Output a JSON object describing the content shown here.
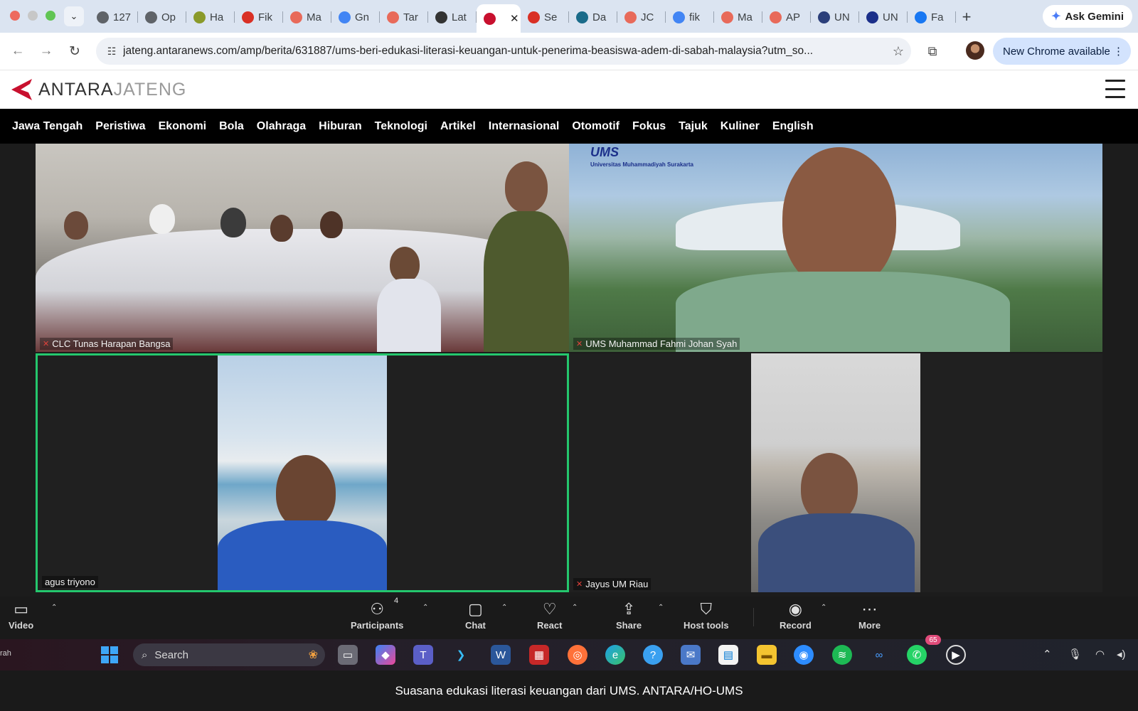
{
  "browser": {
    "tabs": [
      {
        "label": "127",
        "icon": "globe-icon",
        "color": "#5f6368"
      },
      {
        "label": "Op",
        "icon": "openai-icon",
        "color": "#5f6368"
      },
      {
        "label": "Ha",
        "icon": "seal-icon",
        "color": "#8a9a2a"
      },
      {
        "label": "Fik",
        "icon": "r-icon",
        "color": "#d93025"
      },
      {
        "label": "Ma",
        "icon": "asterisk-icon",
        "color": "#e86a5a"
      },
      {
        "label": "Gn",
        "icon": "google-icon",
        "color": "#4285f4"
      },
      {
        "label": "Tar",
        "icon": "asterisk-icon",
        "color": "#e86a5a"
      },
      {
        "label": "Lat",
        "icon": "openai-icon",
        "color": "#333333"
      },
      {
        "label": "",
        "icon": "antara-icon",
        "color": "#c8102e",
        "active": true
      },
      {
        "label": "Se",
        "icon": "c-icon",
        "color": "#d93025"
      },
      {
        "label": "Da",
        "icon": "doc-icon",
        "color": "#1a6b8a"
      },
      {
        "label": "JC",
        "icon": "asterisk-icon",
        "color": "#e86a5a"
      },
      {
        "label": "fik",
        "icon": "google-icon",
        "color": "#4285f4"
      },
      {
        "label": "Ma",
        "icon": "asterisk-icon",
        "color": "#e86a5a"
      },
      {
        "label": "AP",
        "icon": "asterisk-icon",
        "color": "#e86a5a"
      },
      {
        "label": "UN",
        "icon": "seal-icon",
        "color": "#2b3f7a"
      },
      {
        "label": "UN",
        "icon": "ums-icon",
        "color": "#1b2f8a"
      },
      {
        "label": "Fa",
        "icon": "facebook-icon",
        "color": "#1877f2"
      }
    ],
    "close_glyph": "✕",
    "new_tab_glyph": "+",
    "gemini_label": "Ask Gemini",
    "url": "jateng.antaranews.com/amp/berita/631887/ums-beri-edukasi-literasi-keuangan-untuk-penerima-beasiswa-adem-di-sabah-malaysia?utm_so...",
    "update_label": "New Chrome available"
  },
  "site": {
    "logo_primary": "ANTARA",
    "logo_secondary": "JATENG",
    "nav": [
      "Jawa Tengah",
      "Peristiwa",
      "Ekonomi",
      "Bola",
      "Olahraga",
      "Hiburan",
      "Teknologi",
      "Artikel",
      "Internasional",
      "Otomotif",
      "Fokus",
      "Tajuk",
      "Kuliner",
      "English"
    ],
    "brand_color": "#c8102e"
  },
  "image": {
    "tiles": [
      {
        "name": "CLC Tunas Harapan Bangsa",
        "muted": true
      },
      {
        "name": "UMS Muhammad Fahmi Johan Syah",
        "muted": true
      },
      {
        "name": "agus triyono",
        "muted": false,
        "active_speaker": true
      },
      {
        "name": "Jayus UM Riau",
        "muted": true
      }
    ],
    "ums_logo_text": "UMS",
    "ums_logo_sub": "Universitas Muhammadiyah Surakarta",
    "zoom_controls": {
      "video": "Video",
      "participants": "Participants",
      "participants_count": "4",
      "chat": "Chat",
      "react": "React",
      "share": "Share",
      "host_tools": "Host tools",
      "record": "Record",
      "more": "More"
    },
    "taskbar": {
      "left_text": "rah",
      "search": "Search",
      "whatsapp_badge": "65"
    }
  },
  "caption": "Suasana edukasi literasi keuangan dari UMS. ANTARA/HO-UMS"
}
